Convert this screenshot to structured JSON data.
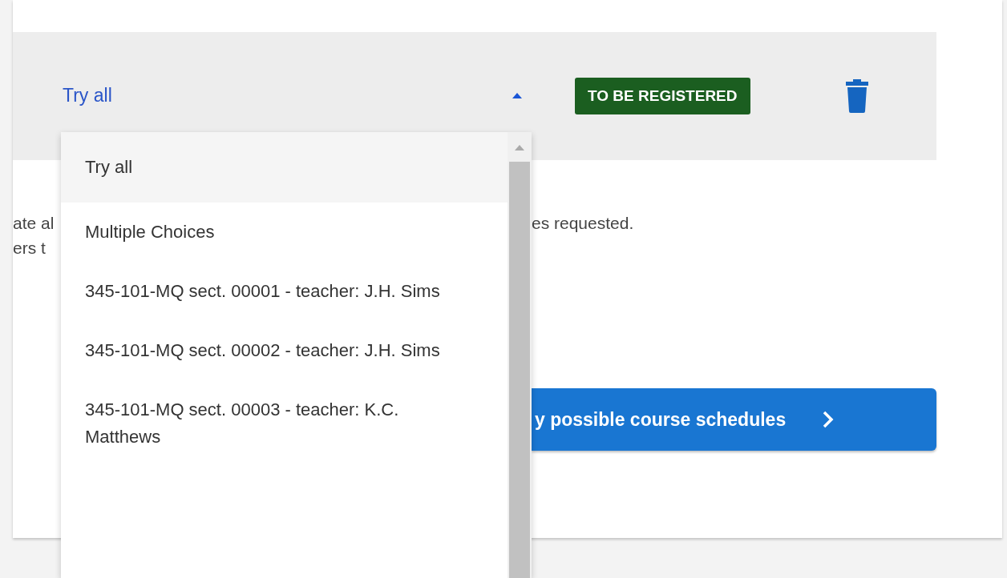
{
  "selector": {
    "value": "Try all",
    "expanded": true
  },
  "status_badge": {
    "label": "TO BE REGISTERED"
  },
  "background_text": {
    "left_lines": [
      "ate al",
      "ers t"
    ],
    "right_line": "es requested."
  },
  "action_button": {
    "label": "y possible course schedules"
  },
  "options": [
    {
      "label": "Try all",
      "selected": true
    },
    {
      "label": "Multiple Choices",
      "selected": false
    },
    {
      "label": "345-101-MQ sect. 00001 - teacher: J.H. Sims",
      "selected": false
    },
    {
      "label": "345-101-MQ sect. 00002 - teacher: J.H. Sims",
      "selected": false
    },
    {
      "label": "345-101-MQ sect. 00003 - teacher: K.C. Matthews",
      "selected": false
    }
  ]
}
